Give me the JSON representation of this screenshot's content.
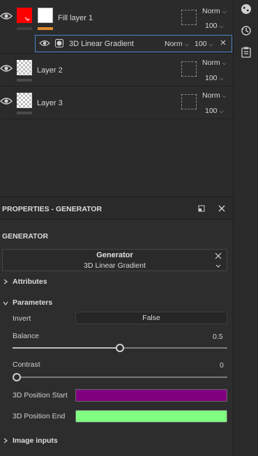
{
  "layers": [
    {
      "name": "Fill layer 1",
      "blend": "Norm",
      "opacity": "100",
      "color_thumb": "#ff0000",
      "accent": "#e08a2c"
    },
    {
      "name": "Layer 2",
      "blend": "Norm",
      "opacity": "100"
    },
    {
      "name": "Layer 3",
      "blend": "Norm",
      "opacity": "100"
    }
  ],
  "effect": {
    "name": "3D Linear Gradient",
    "blend": "Norm",
    "opacity": "100"
  },
  "properties": {
    "header_title": "PROPERTIES - GENERATOR",
    "section_title": "GENERATOR",
    "generator_label": "Generator",
    "generator_value": "3D Linear Gradient",
    "attributes_label": "Attributes",
    "parameters_label": "Parameters",
    "invert": {
      "label": "Invert",
      "value": "False"
    },
    "balance": {
      "label": "Balance",
      "value": "0.5",
      "fraction": 0.5
    },
    "contrast": {
      "label": "Contrast",
      "value": "0",
      "fraction": 0.0
    },
    "pos_start": {
      "label": "3D Position Start",
      "color": "#800080"
    },
    "pos_end": {
      "label": "3D Position End",
      "color": "#80ff80"
    },
    "image_inputs_label": "Image inputs"
  },
  "icons": {
    "right_bar": [
      "globe-icon",
      "history-icon",
      "clipboard-icon"
    ]
  }
}
